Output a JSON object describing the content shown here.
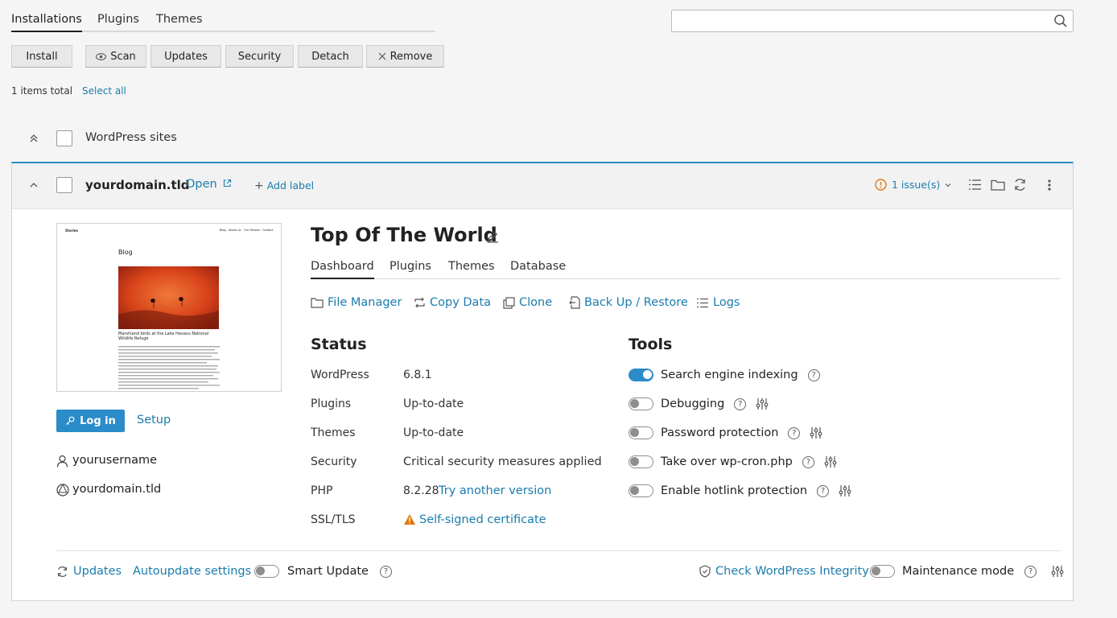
{
  "top_tabs": [
    "Installations",
    "Plugins",
    "Themes"
  ],
  "search": {
    "placeholder": ""
  },
  "toolbar": {
    "install": "Install",
    "scan": "Scan",
    "updates": "Updates",
    "security": "Security",
    "detach": "Detach",
    "remove": "Remove"
  },
  "summary": {
    "total": "1 items total",
    "select_all": "Select all"
  },
  "group": {
    "label": "WordPress sites"
  },
  "site": {
    "domain": "yourdomain.tld",
    "open": "Open",
    "add_label": "Add label",
    "issues": "1 issue(s)",
    "title": "Top Of The World",
    "tabs": [
      "Dashboard",
      "Plugins",
      "Themes",
      "Database"
    ],
    "actions": [
      "File Manager",
      "Copy Data",
      "Clone",
      "Back Up / Restore",
      "Logs"
    ],
    "login": "Log in",
    "setup": "Setup",
    "username": "yourusername",
    "domain_line": "yourdomain.tld"
  },
  "preview": {
    "brand": "Stories",
    "nav": [
      "Blog",
      "About us",
      "Our Mission",
      "Contact"
    ],
    "heading": "Blog",
    "caption": "Marshland birds at the Lake Havasu National Wildlife Refuge"
  },
  "status": {
    "heading": "Status",
    "rows": [
      {
        "label": "WordPress",
        "value": "6.8.1"
      },
      {
        "label": "Plugins",
        "value": "Up-to-date"
      },
      {
        "label": "Themes",
        "value": "Up-to-date"
      },
      {
        "label": "Security",
        "value": "Critical security measures applied"
      },
      {
        "label": "PHP",
        "value": "8.2.28",
        "link": "Try another version"
      },
      {
        "label": "SSL/TLS",
        "value": "Self-signed certificate"
      }
    ]
  },
  "tools": {
    "heading": "Tools",
    "items": [
      {
        "label": "Search engine indexing",
        "on": true
      },
      {
        "label": "Debugging",
        "on": false
      },
      {
        "label": "Password protection",
        "on": false
      },
      {
        "label": "Take over wp-cron.php",
        "on": false
      },
      {
        "label": "Enable hotlink protection",
        "on": false
      }
    ]
  },
  "footer": {
    "updates": "Updates",
    "autoupdate": "Autoupdate settings",
    "smart_update": "Smart Update",
    "integrity": "Check WordPress Integrity",
    "maintenance": "Maintenance mode"
  },
  "colors": {
    "accent": "#2a8cc9",
    "link": "#1a7cad",
    "warning": "#e07a10"
  }
}
